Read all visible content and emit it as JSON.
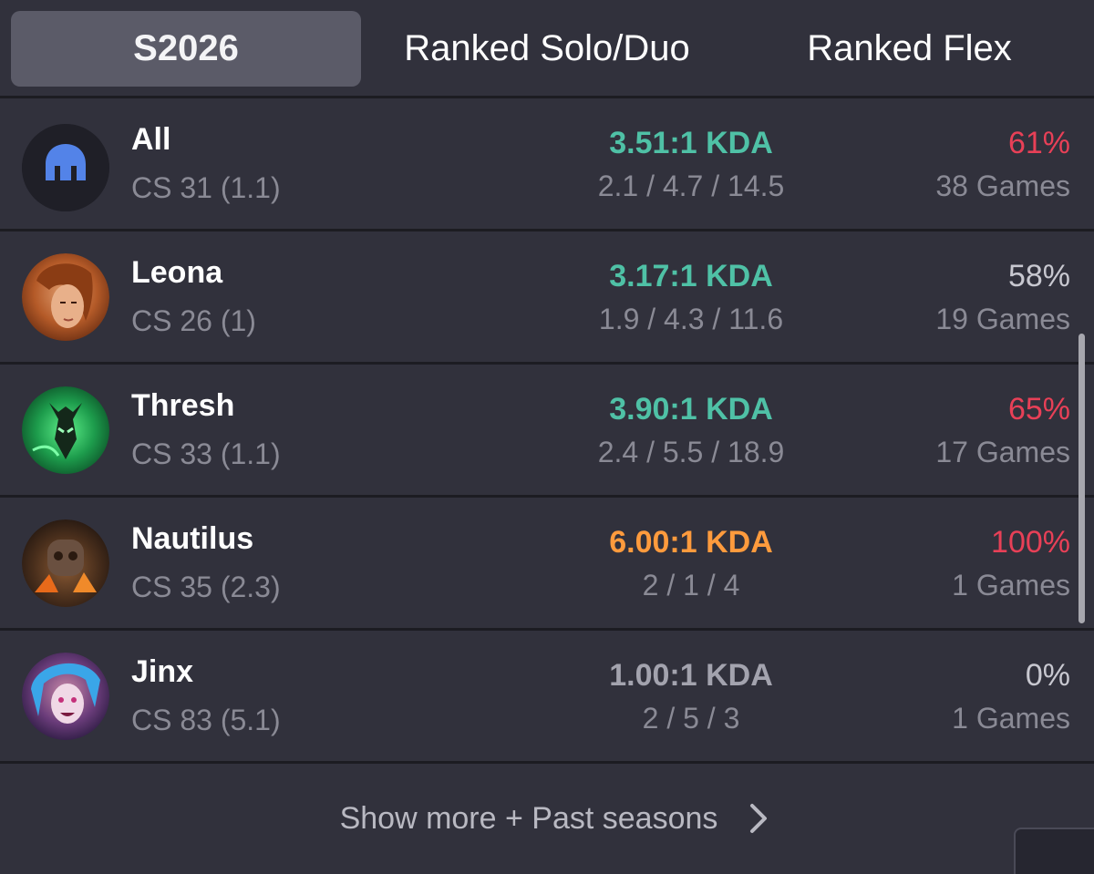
{
  "tabs": [
    {
      "label": "S2026",
      "active": true
    },
    {
      "label": "Ranked Solo/Duo",
      "active": false
    },
    {
      "label": "Ranked Flex",
      "active": false
    }
  ],
  "colors": {
    "kda_teal": "#4fc1a6",
    "kda_orange": "#ff9b3d",
    "kda_gray": "#a3a3ae",
    "winrate_red": "#e84057",
    "winrate_gray": "#c8c8d0",
    "background": "#31313c",
    "active_tab": "#5b5b68"
  },
  "rows": [
    {
      "name": "All",
      "icon": "helmet-icon",
      "cs": "CS 31 (1.1)",
      "kda": "3.51:1 KDA",
      "kda_color": "#4fc1a6",
      "kda_detail": "2.1 / 4.7 / 14.5",
      "winrate": "61%",
      "winrate_color": "#e84057",
      "games": "38 Games"
    },
    {
      "name": "Leona",
      "icon": "leona-portrait",
      "cs": "CS 26 (1)",
      "kda": "3.17:1 KDA",
      "kda_color": "#4fc1a6",
      "kda_detail": "1.9 / 4.3 / 11.6",
      "winrate": "58%",
      "winrate_color": "#c8c8d0",
      "games": "19 Games"
    },
    {
      "name": "Thresh",
      "icon": "thresh-portrait",
      "cs": "CS 33 (1.1)",
      "kda": "3.90:1 KDA",
      "kda_color": "#4fc1a6",
      "kda_detail": "2.4 / 5.5 / 18.9",
      "winrate": "65%",
      "winrate_color": "#e84057",
      "games": "17 Games"
    },
    {
      "name": "Nautilus",
      "icon": "nautilus-portrait",
      "cs": "CS 35 (2.3)",
      "kda": "6.00:1 KDA",
      "kda_color": "#ff9b3d",
      "kda_detail": "2 / 1 / 4",
      "winrate": "100%",
      "winrate_color": "#e84057",
      "games": "1 Games"
    },
    {
      "name": "Jinx",
      "icon": "jinx-portrait",
      "cs": "CS 83 (5.1)",
      "kda": "1.00:1 KDA",
      "kda_color": "#a3a3ae",
      "kda_detail": "2 / 5 / 3",
      "winrate": "0%",
      "winrate_color": "#c8c8d0",
      "games": "1 Games"
    }
  ],
  "footer": {
    "show_more": "Show more + Past seasons",
    "chevron_icon": "chevron-right-icon"
  }
}
